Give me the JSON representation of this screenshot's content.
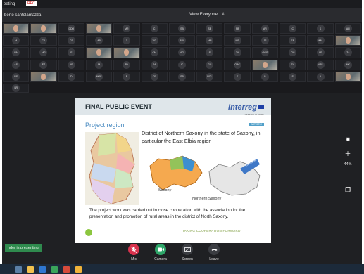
{
  "window": {
    "title": "eeting",
    "rec_label": "REC"
  },
  "topbar": {
    "host": "berto santolamazza",
    "view_label": "View Everyone"
  },
  "participants": [
    {
      "type": "video"
    },
    {
      "type": "video"
    },
    {
      "initials": "DDR"
    },
    {
      "type": "video"
    },
    {
      "initials": "MR"
    },
    {
      "initials": "C"
    },
    {
      "initials": "SB"
    },
    {
      "initials": "SB"
    },
    {
      "initials": "SB"
    },
    {
      "initials": "AR"
    },
    {
      "initials": "C"
    },
    {
      "initials": "K"
    },
    {
      "initials": "AR"
    },
    {
      "initials": "M"
    },
    {
      "initials": "CA"
    },
    {
      "initials": "CS"
    },
    {
      "initials": "AB"
    },
    {
      "initials": "Z"
    },
    {
      "initials": "VG"
    },
    {
      "initials": "APL"
    },
    {
      "initials": "MR"
    },
    {
      "initials": "MS"
    },
    {
      "initials": "JS"
    },
    {
      "initials": "EB"
    },
    {
      "initials": "MAL"
    },
    {
      "type": "video"
    },
    {
      "initials": "PA"
    },
    {
      "initials": "MG"
    },
    {
      "initials": "F"
    },
    {
      "type": "video"
    },
    {
      "type": "video"
    },
    {
      "initials": "CM"
    },
    {
      "initials": "AG"
    },
    {
      "initials": "S"
    },
    {
      "initials": "TA"
    },
    {
      "initials": "OGS"
    },
    {
      "initials": "CM"
    },
    {
      "initials": "AF"
    },
    {
      "initials": "ZA"
    },
    {
      "initials": "AS"
    },
    {
      "initials": "EZ"
    },
    {
      "initials": "AP"
    },
    {
      "initials": "M"
    },
    {
      "initials": "PA"
    },
    {
      "initials": "SA"
    },
    {
      "initials": "IC"
    },
    {
      "initials": "GC"
    },
    {
      "initials": "OBC"
    },
    {
      "type": "video"
    },
    {
      "initials": "SV"
    },
    {
      "initials": "NPS"
    },
    {
      "initials": "MC"
    },
    {
      "initials": "RS"
    },
    {
      "type": "video"
    },
    {
      "initials": "D"
    },
    {
      "initials": "MOE"
    },
    {
      "initials": "F"
    },
    {
      "initials": "CE"
    },
    {
      "initials": "SB"
    },
    {
      "initials": "ROL"
    },
    {
      "initials": "E"
    },
    {
      "initials": "B"
    },
    {
      "initials": "S"
    },
    {
      "initials": "A"
    },
    {
      "type": "video"
    },
    {
      "initials": "SR"
    }
  ],
  "slide": {
    "title": "FINAL PUBLIC EVENT",
    "brand": "interreg",
    "brand_sub": "CENTRAL EUROPE",
    "brand_tag": "ARTISTIC",
    "section": "Project region",
    "description": "District of Northern Saxony in the state of Saxony, in particular the East Elbia region",
    "label_saxony": "Saxony",
    "label_north": "Northern Saxony",
    "body": "The project work was carried out in close cooperation with the association for the preservation and promotion of rural areas in the district of North Saxony.",
    "footer": "TAKING COOPERATION FORWARD"
  },
  "side_controls": {
    "zoom": "44%"
  },
  "presenting_label": "nder is presenting",
  "controls": [
    {
      "label": "Mic",
      "color": "#d9324d"
    },
    {
      "label": "Camera",
      "color": "#2fa76a"
    },
    {
      "label": "Screen",
      "color": "#3b3d42"
    },
    {
      "label": "Leave",
      "color": "#3b3d42"
    }
  ]
}
